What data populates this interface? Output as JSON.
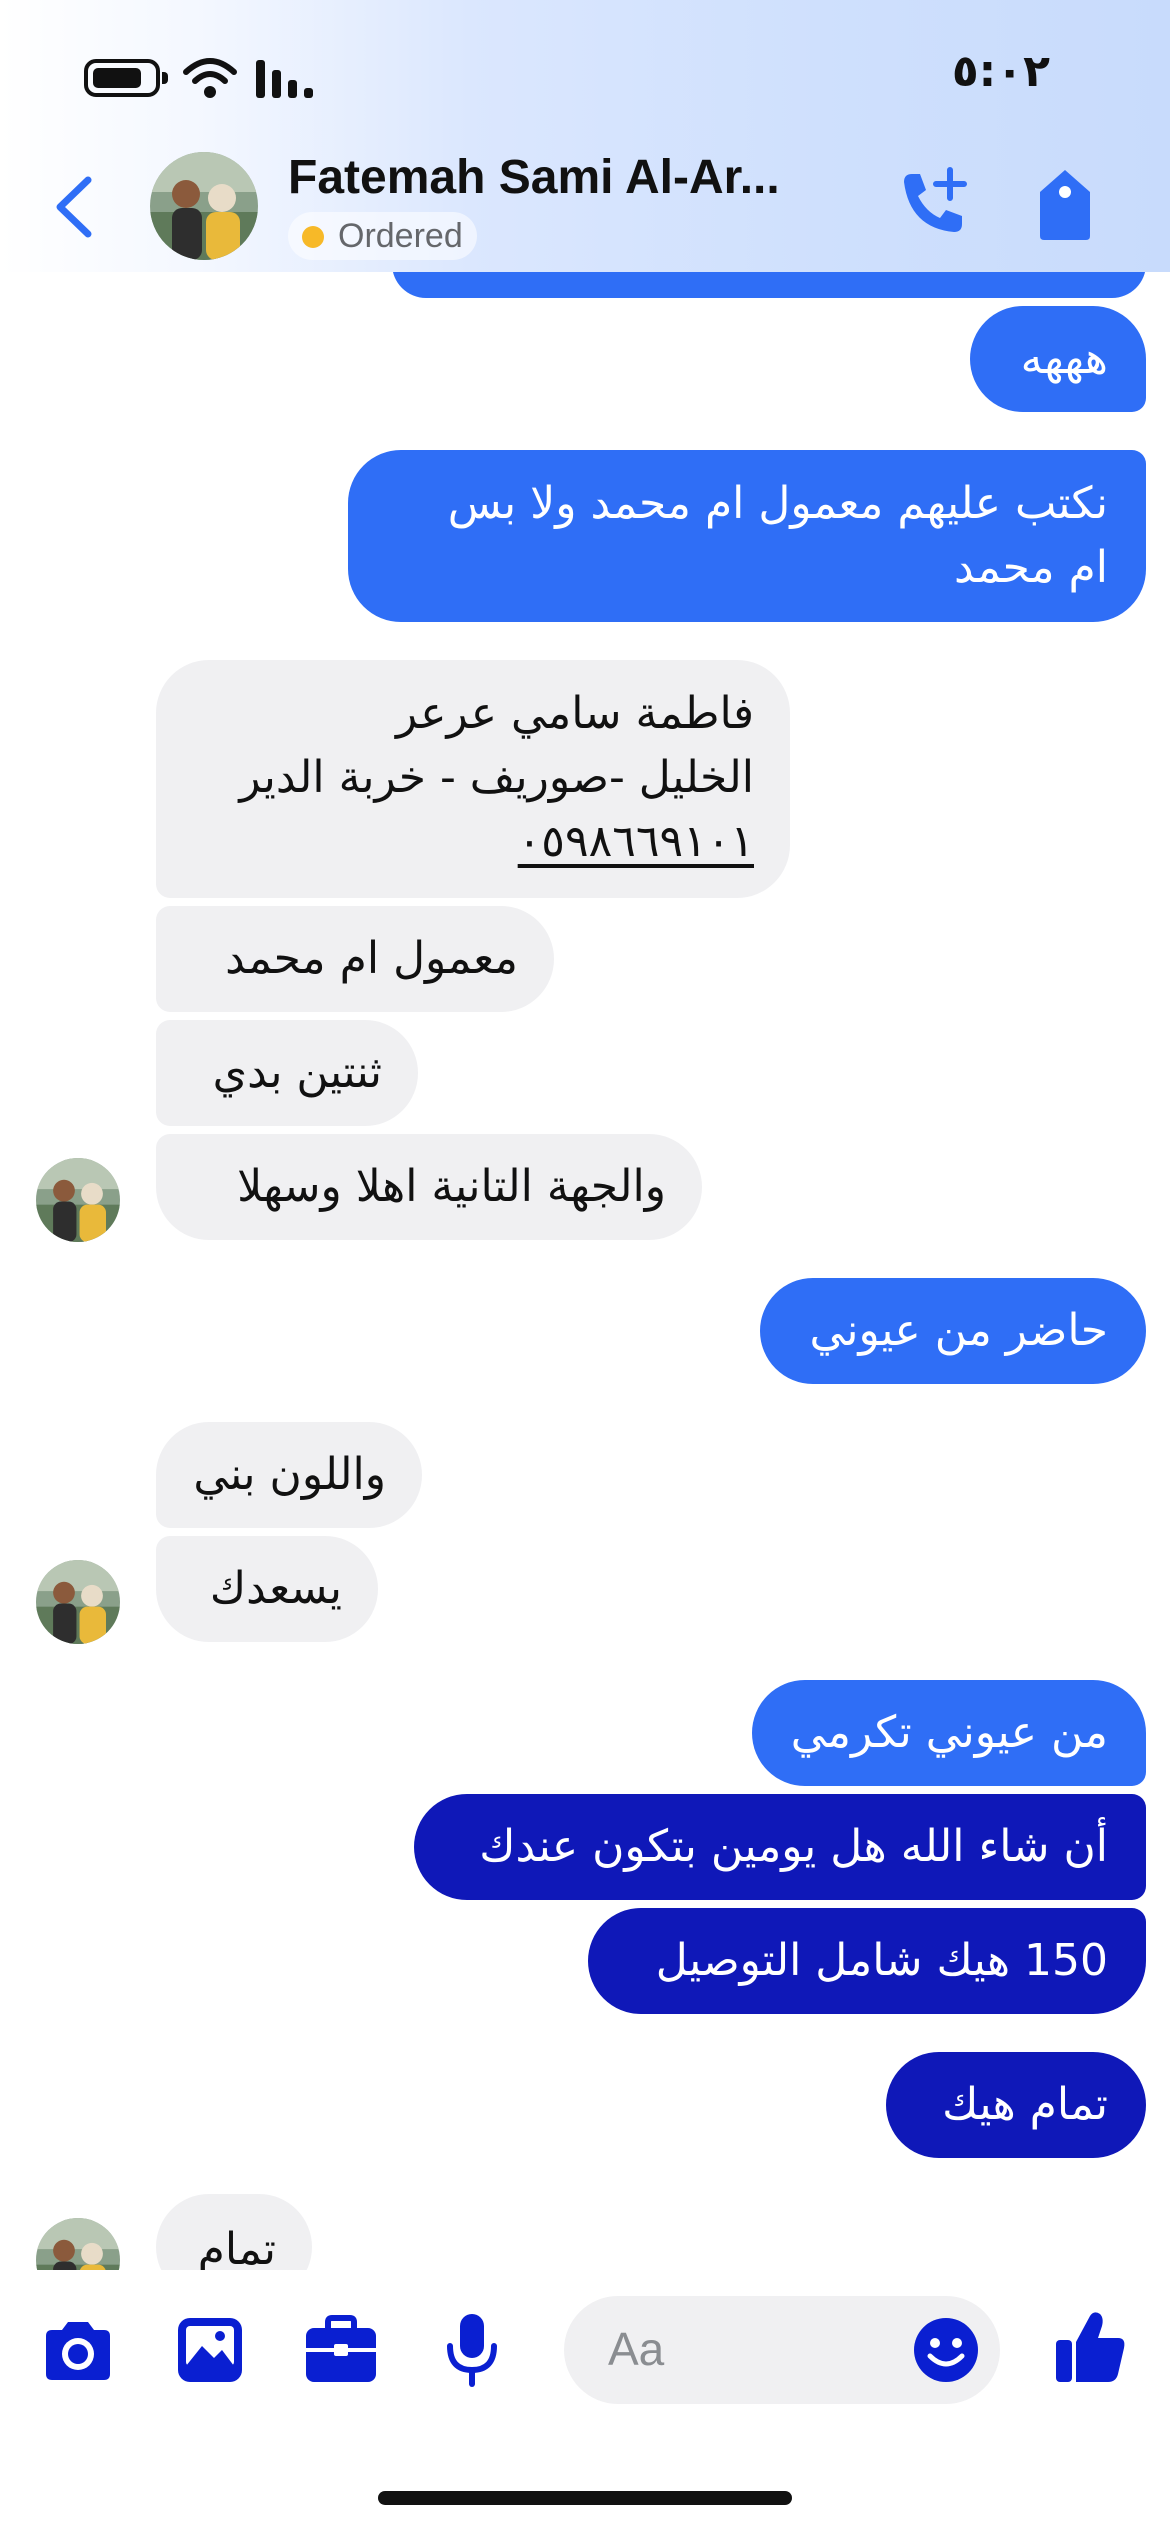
{
  "status": {
    "time": "٥:٠٢"
  },
  "header": {
    "contact_name": "Fatemah Sami Al-Ar...",
    "order_status": "Ordered",
    "order_dot_color": "#f7b928",
    "accent": "#2f6ef6"
  },
  "messages": [
    {
      "direction": "out",
      "lines": [
        "هههه"
      ]
    },
    {
      "direction": "out",
      "lines": [
        "نكتب عليهم معمول ام محمد ولا بس",
        "ام محمد"
      ]
    },
    {
      "direction": "in",
      "lines": [
        "فاطمة سامي عرعر",
        "الخليل -صوريف - خربة الدير",
        "٠٥٩٨٦٦٩١٠١"
      ]
    },
    {
      "direction": "in",
      "lines": [
        "معمول ام محمد"
      ]
    },
    {
      "direction": "in",
      "lines": [
        "ثنتين بدي"
      ]
    },
    {
      "direction": "in",
      "lines": [
        "والجهة التانية اهلا وسهلا"
      ]
    },
    {
      "direction": "out",
      "lines": [
        "حاضر من عيوني"
      ]
    },
    {
      "direction": "in",
      "lines": [
        "واللون بني"
      ]
    },
    {
      "direction": "in",
      "lines": [
        "يسعدك"
      ]
    },
    {
      "direction": "out",
      "lines": [
        "من عيوني تكرمي"
      ]
    },
    {
      "direction": "out",
      "lines": [
        "أن شاء الله هل يومين بتكون عندك"
      ]
    },
    {
      "direction": "out",
      "lines": [
        "150 هيك شامل التوصيل"
      ]
    },
    {
      "direction": "out",
      "lines": [
        "تمام هيك"
      ]
    },
    {
      "direction": "in",
      "lines": [
        "تمام"
      ]
    }
  ],
  "composer": {
    "placeholder": "Aa",
    "icons": [
      "camera-icon",
      "gallery-icon",
      "briefcase-icon",
      "microphone-icon",
      "emoji-icon",
      "thumbs-up-icon"
    ],
    "icon_color": "#0a1fd1"
  }
}
